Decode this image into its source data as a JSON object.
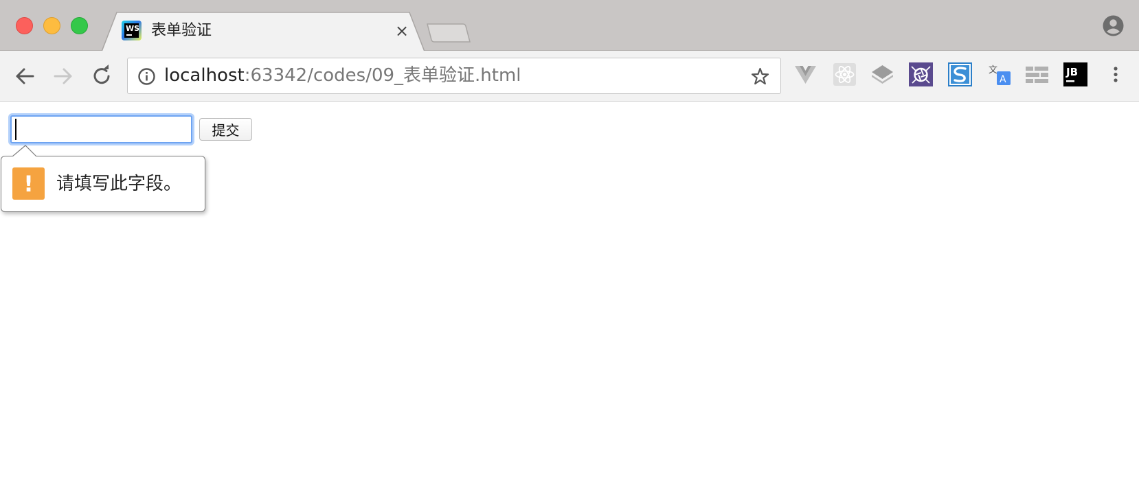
{
  "tab": {
    "title": "表单验证",
    "favicon_text": "WS",
    "close_glyph": "×"
  },
  "address_bar": {
    "host": "localhost",
    "path": ":63342/codes/09_表单验证.html"
  },
  "extensions": [
    {
      "name": "vue-devtools-icon"
    },
    {
      "name": "react-devtools-icon"
    },
    {
      "name": "layers-icon"
    },
    {
      "name": "aperture-extension-icon"
    },
    {
      "name": "s-extension-icon"
    },
    {
      "name": "translate-icon"
    },
    {
      "name": "grid-extension-icon"
    },
    {
      "name": "jetbrains-icon",
      "label": "JB"
    }
  ],
  "form": {
    "input_value": "",
    "submit_label": "提交"
  },
  "validation_tooltip": {
    "icon_glyph": "!",
    "message": "请填写此字段。"
  },
  "colors": {
    "focus_ring": "#6ea4f2",
    "warning": "#f5a340",
    "chrome_bg": "#f2f2f2",
    "titlebar_bg": "#c9c6c5"
  }
}
